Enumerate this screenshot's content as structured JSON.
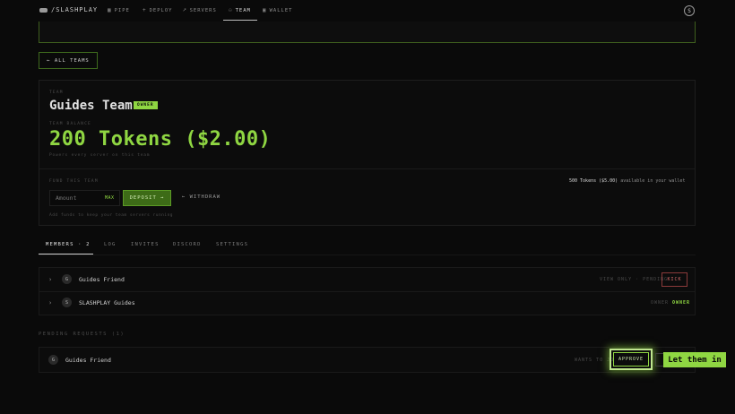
{
  "nav": {
    "brand": "/SLASHPLAY",
    "items": [
      {
        "label": "PIPE",
        "icon": "grid-icon"
      },
      {
        "label": "DEPLOY",
        "icon": "plus-icon"
      },
      {
        "label": "SERVERS",
        "icon": "rocket-icon"
      },
      {
        "label": "TEAM",
        "icon": "team-icon"
      },
      {
        "label": "WALLET",
        "icon": "wallet-icon"
      }
    ],
    "active": "TEAM",
    "user_initial": "S"
  },
  "back_label": "← ALL TEAMS",
  "team": {
    "label": "TEAM",
    "name": "Guides Team",
    "badge": "OWNER",
    "balance_label": "TEAM BALANCE",
    "balance": "200 Tokens ($2.00)",
    "balance_sub": "Powers every server on this team"
  },
  "fund": {
    "label": "FUND THIS TEAM",
    "wallet_amount": "500 Tokens ($5.00)",
    "wallet_suffix": "available in your wallet",
    "amount_placeholder": "Amount",
    "max_label": "MAX",
    "deposit_label": "DEPOSIT →",
    "withdraw_label": "← WITHDRAW",
    "hint": "Add funds to keep your team servers running"
  },
  "tabs": [
    {
      "label": "MEMBERS · 2"
    },
    {
      "label": "LOG"
    },
    {
      "label": "INVITES"
    },
    {
      "label": "DISCORD"
    },
    {
      "label": "SETTINGS"
    }
  ],
  "members": [
    {
      "initial": "G",
      "name": "Guides Friend",
      "role": "VIEW ONLY · PENDING",
      "action": "KICK"
    },
    {
      "initial": "S",
      "name": "SLASHPLAY Guides",
      "role": "OWNER ·",
      "tag": "OWNER"
    }
  ],
  "pending": {
    "label": "PENDING REQUESTS (1)",
    "items": [
      {
        "initial": "G",
        "name": "Guides Friend",
        "note": "WANTS TO JOIN",
        "approve_label": "APPROVE"
      }
    ]
  },
  "callout": "Let them in",
  "colors": {
    "accent": "#8fd642",
    "background": "#0a0a0a",
    "danger": "#d46a6a"
  }
}
